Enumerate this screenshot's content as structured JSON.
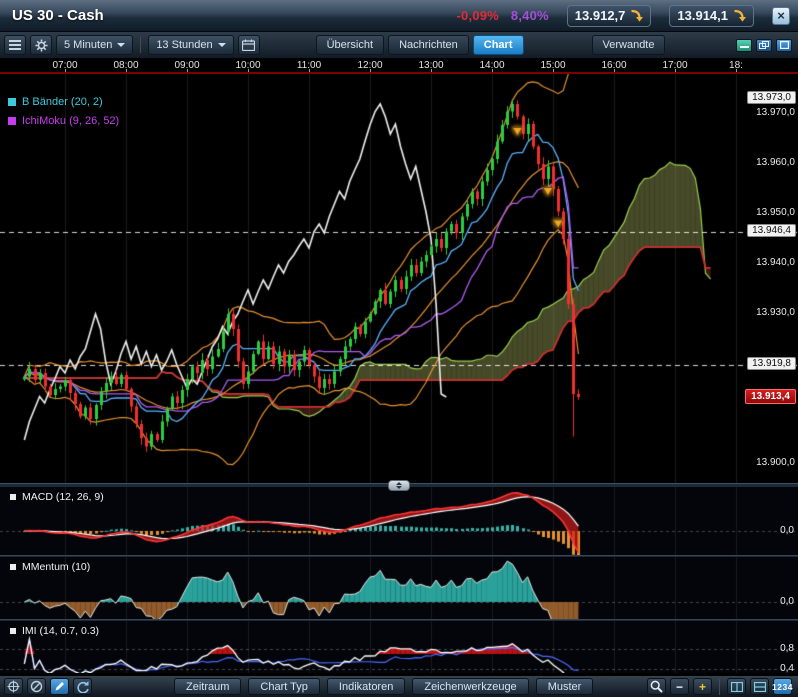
{
  "titlebar": {
    "title": "US 30 - Cash",
    "change_pct": "-0,09%",
    "range_pct": "8,40%",
    "sell_price": "13.912,7",
    "buy_price": "13.914,1",
    "close_glyph": "×"
  },
  "toolbar": {
    "timeframe": "5 Minuten",
    "span": "13 Stunden",
    "tabs": [
      {
        "label": "Übersicht",
        "active": false
      },
      {
        "label": "Nachrichten",
        "active": false
      },
      {
        "label": "Chart",
        "active": true
      },
      {
        "label": "Verwandte",
        "active": false
      }
    ]
  },
  "chart": {
    "legend": [
      {
        "label": "B Bänder (20, 2)",
        "color": "#3fc8dc"
      },
      {
        "label": "IchiMoku (9, 26, 52)",
        "color": "#c83cf0"
      }
    ],
    "time_axis": [
      "07:00",
      "08:00",
      "09:00",
      "10:00",
      "11:00",
      "12:00",
      "13:00",
      "14:00",
      "15:00",
      "16:00",
      "17:00",
      "18:"
    ],
    "price_axis": {
      "plain": [
        {
          "label": "13.970,0",
          "value": 13970
        },
        {
          "label": "13.960,0",
          "value": 13960
        },
        {
          "label": "13.950,0",
          "value": 13950
        },
        {
          "label": "13.940,0",
          "value": 13940
        },
        {
          "label": "13.930,0",
          "value": 13930
        },
        {
          "label": "13.900,0",
          "value": 13900
        }
      ],
      "boxed": [
        {
          "label": "13.973,0",
          "value": 13973,
          "dashed": false
        },
        {
          "label": "13.946,4",
          "value": 13946.4,
          "dashed": true
        },
        {
          "label": "13.919,8",
          "value": 13919.8,
          "dashed": true
        }
      ],
      "last": {
        "label": "13.913,4",
        "value": 13913.4
      }
    },
    "panels": [
      {
        "title": "MACD (12, 26, 9)",
        "levels": [
          {
            "label": "0,0",
            "value": 0
          }
        ]
      },
      {
        "title": "MMentum (10)",
        "levels": [
          {
            "label": "0,0",
            "value": 0
          }
        ]
      },
      {
        "title": "IMI (14, 0.7, 0.3)",
        "levels": [
          {
            "label": "0,8",
            "value": 0.8
          },
          {
            "label": "0,4",
            "value": 0.4
          }
        ]
      }
    ]
  },
  "bottom_toolbar": {
    "buttons": [
      "Zeitraum",
      "Chart Typ",
      "Indikatoren",
      "Zeichenwerkzeuge",
      "Muster"
    ],
    "zoom_out_glyph": "−",
    "zoom_in_glyph": "+",
    "values_glyph": "1234"
  },
  "colors": {
    "candle_up": "#2ecc40",
    "candle_down": "#f03030",
    "bollinger": "#e6922e",
    "tenkan": "#58b2ff",
    "kijun": "#b05cf0",
    "senkou_a": "#9acc4e",
    "senkou_b": "#cc3030",
    "cloud_bull": "rgba(140,148,80,0.5)",
    "cloud_bear": "rgba(150,62,46,0.4)",
    "chikou": "#f0f0f0",
    "macd_line": "#ff3434",
    "macd_signal": "#ffffff",
    "macd_fill": "rgba(205,28,28,0.7)",
    "hist_pos": "#2fb3ab",
    "hist_neg": "#e6922e",
    "momentum_pos": "#2fb3ab",
    "momentum_neg": "#a2652f",
    "imi_line": "#ffffff",
    "imi_fill": "#cc1414",
    "imi_slow": "#4a6cff",
    "marker": "#f0a828",
    "grid": "#1b1b1b"
  },
  "chart_data": {
    "type": "candlestick",
    "start_time": "06:20",
    "step_minutes": 5,
    "open_equals_previous_close": true,
    "closes": [
      13917.5,
      13919.0,
      13916.8,
      13918.2,
      13915.5,
      13913.8,
      13915.0,
      13915.5,
      13916.8,
      13914.2,
      13912.0,
      13909.5,
      13911.3,
      13909.0,
      13911.8,
      13914.5,
      13916.2,
      13917.5,
      13916.0,
      13917.8,
      13915.0,
      13911.5,
      13908.0,
      13905.2,
      13903.5,
      13906.0,
      13904.8,
      13908.5,
      13911.0,
      13913.5,
      13912.2,
      13914.8,
      13917.0,
      13919.5,
      13918.2,
      13920.8,
      13919.0,
      13921.5,
      13923.0,
      13926.5,
      13930.0,
      13927.0,
      13920.5,
      13916.0,
      13918.5,
      13922.0,
      13924.5,
      13921.0,
      13923.5,
      13920.0,
      13922.5,
      13919.5,
      13921.8,
      13918.8,
      13920.5,
      13922.8,
      13919.8,
      13917.5,
      13915.2,
      13917.0,
      13916.0,
      13918.5,
      13921.0,
      13923.5,
      13925.0,
      13927.5,
      13926.0,
      13928.5,
      13930.0,
      13932.5,
      13934.8,
      13932.0,
      13934.5,
      13936.8,
      13935.0,
      13937.5,
      13939.8,
      13938.2,
      13940.5,
      13941.8,
      13943.5,
      13945.0,
      13943.2,
      13946.5,
      13948.0,
      13946.2,
      13949.5,
      13952.0,
      13954.5,
      13953.0,
      13956.5,
      13958.8,
      13961.0,
      13964.5,
      13967.8,
      13970.5,
      13972.0,
      13969.5,
      13966.0,
      13968.0,
      13963.5,
      13960.0,
      13957.0,
      13959.5,
      13955.0,
      13950.5,
      13945.0,
      13932.0,
      13914.0,
      13913.4
    ],
    "crash_low": 13905.5,
    "indicators": {
      "bollinger": {
        "period": 20,
        "stddev": 2
      },
      "ichimoku": {
        "tenkan": 9,
        "kijun": 26,
        "senkou_b": 52,
        "displacement": 26
      },
      "macd": {
        "fast": 12,
        "slow": 26,
        "signal": 9
      },
      "momentum": {
        "period": 10
      },
      "imi": {
        "period": 14,
        "overbought": 0.7,
        "oversold": 0.3
      }
    },
    "sell_markers": [
      {
        "time": "14:25",
        "price": 13966.5
      },
      {
        "time": "14:55",
        "price": 13954.5
      },
      {
        "time": "15:05",
        "price": 13948.0
      }
    ]
  }
}
